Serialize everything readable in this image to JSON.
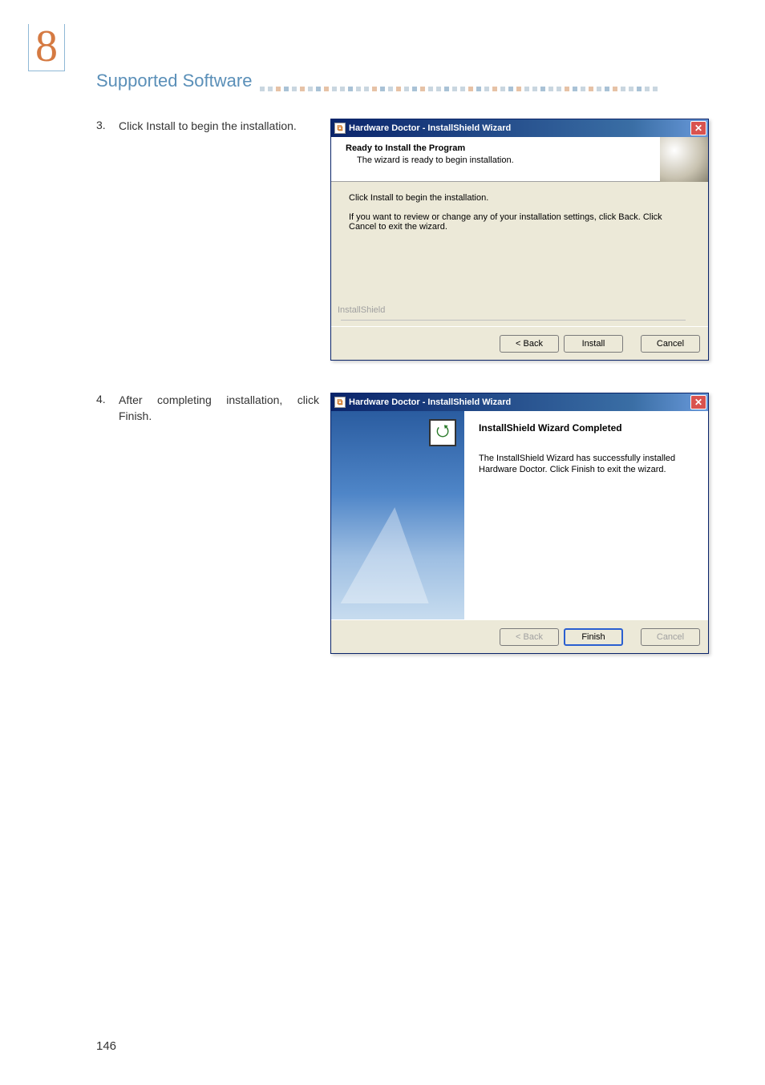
{
  "chapter_number": "8",
  "section_title": "Supported Software",
  "page_number": "146",
  "steps": [
    {
      "num": "3.",
      "text": "Click Install to begin the installation."
    },
    {
      "num": "4.",
      "text": "After completing installa­tion, click Finish."
    }
  ],
  "dialog1": {
    "title": "Hardware Doctor - InstallShield Wizard",
    "header_title": "Ready to Install the Program",
    "header_sub": "The wizard is ready to begin installation.",
    "body_line1": "Click Install to begin the installation.",
    "body_line2": "If you want to review or change any of your installation settings, click Back. Click Cancel to exit the wizard.",
    "brand": "InstallShield",
    "buttons": {
      "back": "< Back",
      "install": "Install",
      "cancel": "Cancel"
    }
  },
  "dialog2": {
    "title": "Hardware Doctor - InstallShield Wizard",
    "complete_title": "InstallShield Wizard Completed",
    "complete_body": "The InstallShield Wizard has successfully installed Hardware Doctor. Click Finish to exit the wizard.",
    "buttons": {
      "back": "< Back",
      "finish": "Finish",
      "cancel": "Cancel"
    }
  }
}
